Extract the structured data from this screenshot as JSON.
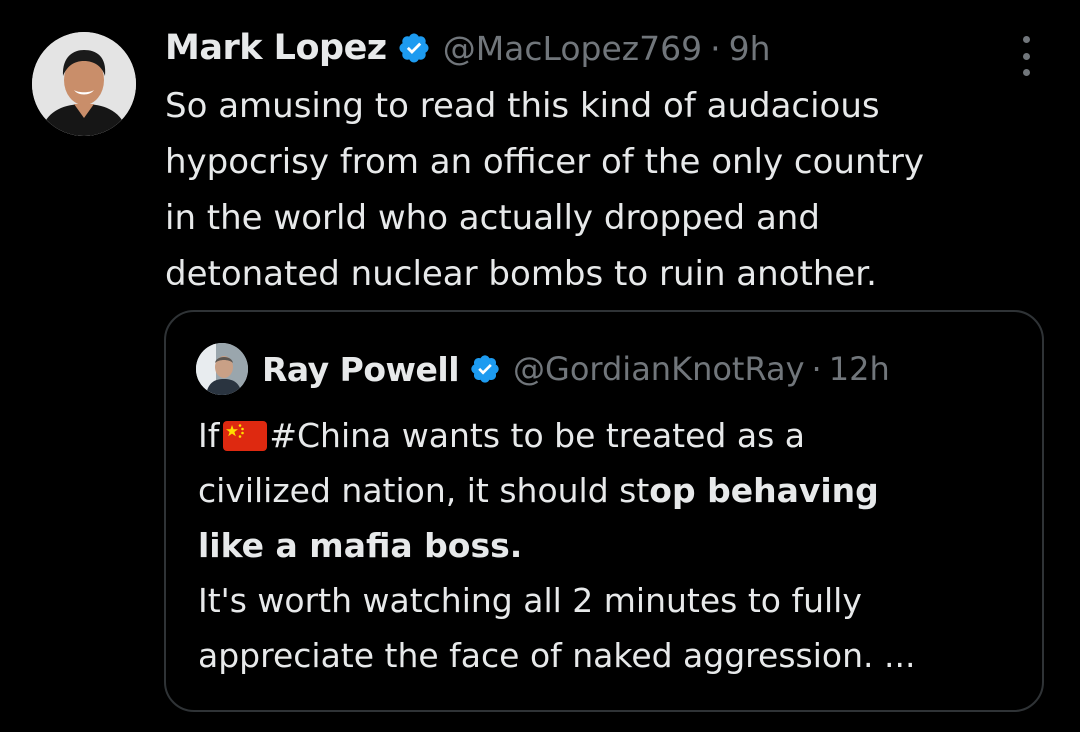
{
  "tweet": {
    "author_name": "Mark Lopez",
    "author_handle": "@MacLopez769",
    "separator": "·",
    "time": "9h",
    "body_lines": [
      "So amusing to read this kind of audacious",
      "hypocrisy from an officer of the only country",
      "in the world who actually dropped and",
      "detonated nuclear bombs to ruin another."
    ]
  },
  "quote": {
    "author_name": "Ray Powell",
    "author_handle": "@GordianKnotRay",
    "separator": "·",
    "time": "12h",
    "line1_prefix": "If",
    "line1_flag_icon": "china-flag-emoji",
    "line1_rest": "#China wants to be treated as a",
    "line2_plain": "civilized nation, it should st",
    "line2_bold": "op behaving",
    "line3_bold": "like a mafia boss.",
    "line4": "It's worth watching all 2 minutes to fully",
    "line5": "appreciate the face of naked aggression. ..."
  },
  "icons": {
    "verified": "verified-badge-icon",
    "more": "more-options-icon"
  },
  "colors": {
    "background": "#000000",
    "text": "#e7e9ea",
    "secondary": "#71767b",
    "verified": "#1d9bf0",
    "border": "#2f3336"
  }
}
